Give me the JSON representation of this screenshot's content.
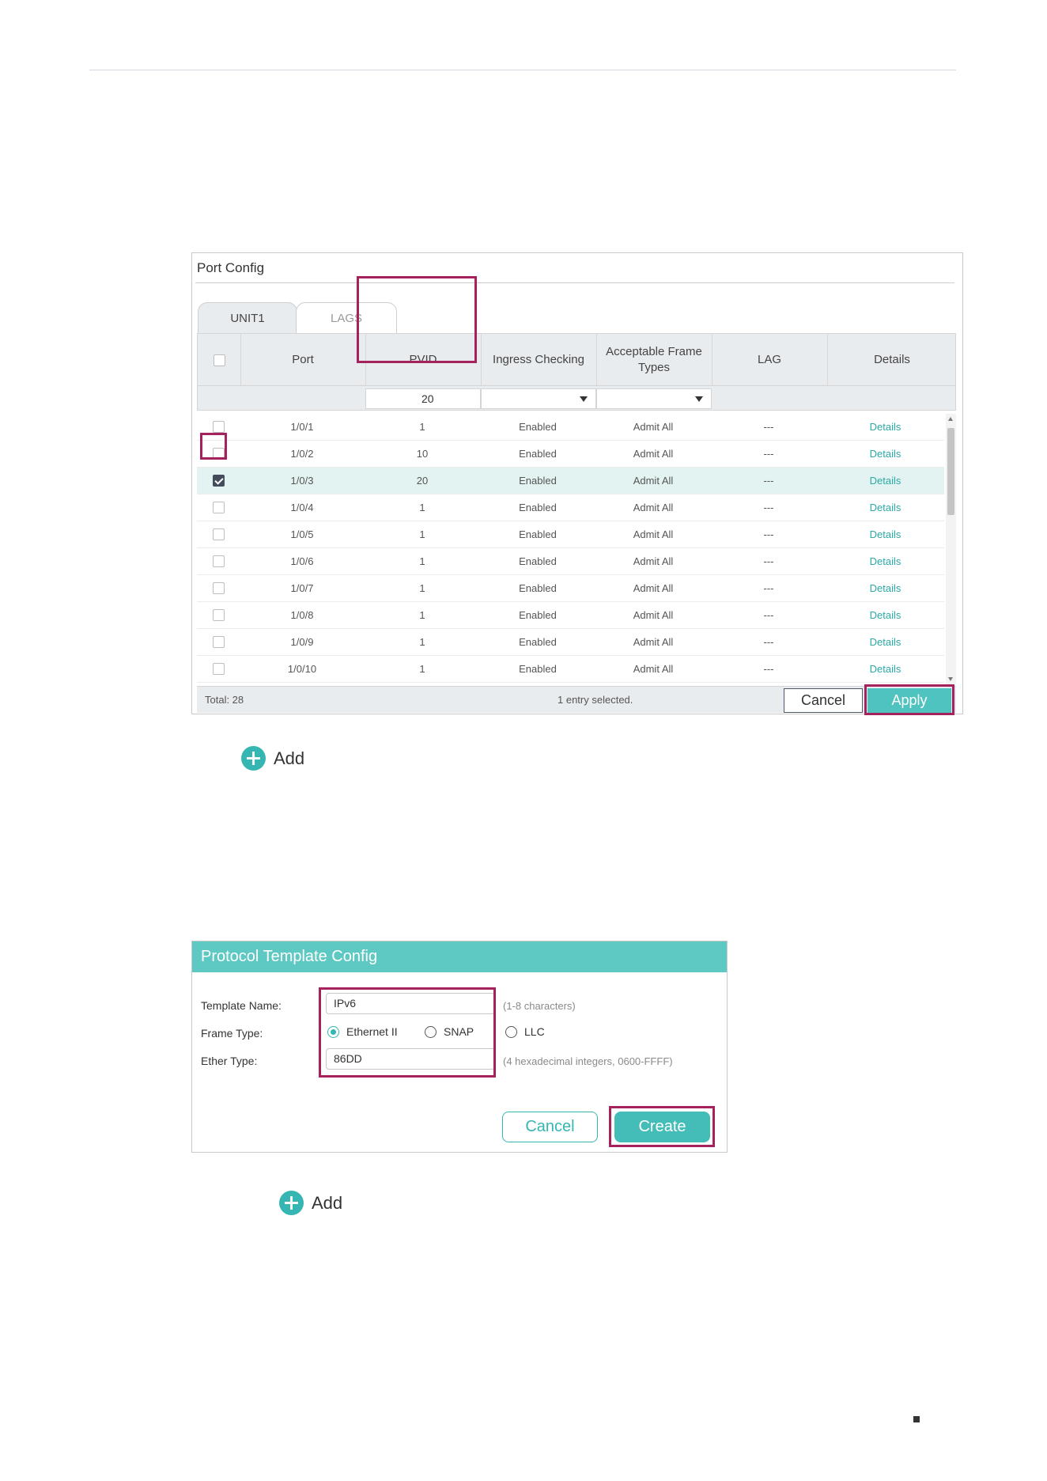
{
  "port_config": {
    "title": "Port Config",
    "tabs": [
      {
        "label": "UNIT1",
        "active": true
      },
      {
        "label": "LAGS",
        "active": false
      }
    ],
    "columns": {
      "port": "Port",
      "pvid": "PVID",
      "ingress": "Ingress Checking",
      "frame_types_line1": "Acceptable Frame",
      "frame_types_line2": "Types",
      "lag": "LAG",
      "details": "Details"
    },
    "filter": {
      "pvid_value": "20"
    },
    "rows": [
      {
        "port": "1/0/1",
        "pvid": "1",
        "ingress": "Enabled",
        "frame_types": "Admit All",
        "lag": "---",
        "details": "Details",
        "checked": false
      },
      {
        "port": "1/0/2",
        "pvid": "10",
        "ingress": "Enabled",
        "frame_types": "Admit All",
        "lag": "---",
        "details": "Details",
        "checked": false
      },
      {
        "port": "1/0/3",
        "pvid": "20",
        "ingress": "Enabled",
        "frame_types": "Admit All",
        "lag": "---",
        "details": "Details",
        "checked": true
      },
      {
        "port": "1/0/4",
        "pvid": "1",
        "ingress": "Enabled",
        "frame_types": "Admit All",
        "lag": "---",
        "details": "Details",
        "checked": false
      },
      {
        "port": "1/0/5",
        "pvid": "1",
        "ingress": "Enabled",
        "frame_types": "Admit All",
        "lag": "---",
        "details": "Details",
        "checked": false
      },
      {
        "port": "1/0/6",
        "pvid": "1",
        "ingress": "Enabled",
        "frame_types": "Admit All",
        "lag": "---",
        "details": "Details",
        "checked": false
      },
      {
        "port": "1/0/7",
        "pvid": "1",
        "ingress": "Enabled",
        "frame_types": "Admit All",
        "lag": "---",
        "details": "Details",
        "checked": false
      },
      {
        "port": "1/0/8",
        "pvid": "1",
        "ingress": "Enabled",
        "frame_types": "Admit All",
        "lag": "---",
        "details": "Details",
        "checked": false
      },
      {
        "port": "1/0/9",
        "pvid": "1",
        "ingress": "Enabled",
        "frame_types": "Admit All",
        "lag": "---",
        "details": "Details",
        "checked": false
      },
      {
        "port": "1/0/10",
        "pvid": "1",
        "ingress": "Enabled",
        "frame_types": "Admit All",
        "lag": "---",
        "details": "Details",
        "checked": false
      }
    ],
    "footer": {
      "total": "Total: 28",
      "selected": "1 entry selected.",
      "cancel_label": "Cancel",
      "apply_label": "Apply"
    }
  },
  "add_link_1": {
    "label": "Add"
  },
  "protocol_template": {
    "title": "Protocol Template Config",
    "template_name_label": "Template Name:",
    "template_name_value": "IPv6",
    "template_name_hint": "(1-8 characters)",
    "frame_type_label": "Frame Type:",
    "frame_type_options": [
      {
        "label": "Ethernet II",
        "selected": true
      },
      {
        "label": "SNAP",
        "selected": false
      },
      {
        "label": "LLC",
        "selected": false
      }
    ],
    "ether_type_label": "Ether Type:",
    "ether_type_value": "86DD",
    "ether_type_hint": "(4 hexadecimal integers, 0600-FFFF)",
    "cancel_label": "Cancel",
    "create_label": "Create"
  },
  "add_link_2": {
    "label": "Add"
  },
  "colors": {
    "accent_teal": "#35b6b2",
    "header_teal": "#5ec8c2",
    "highlight_magenta": "#a5225c",
    "link_teal": "#2aa9a5"
  }
}
